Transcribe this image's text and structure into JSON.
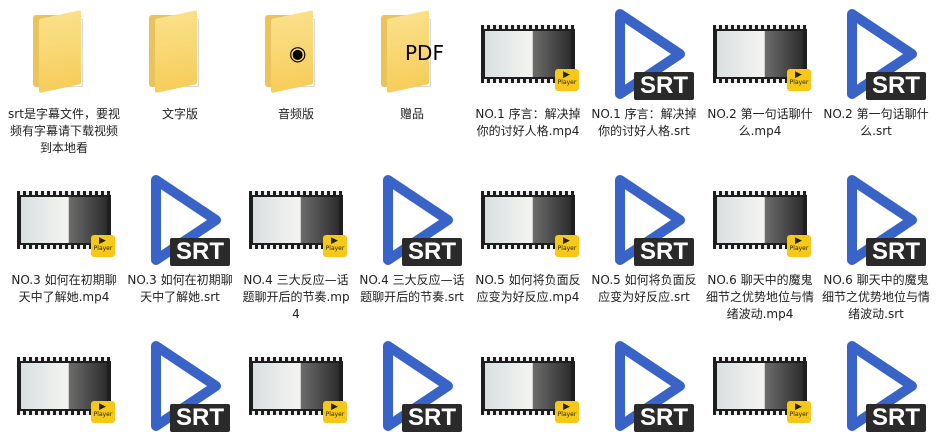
{
  "files": [
    {
      "type": "folder",
      "glyph": "",
      "label": "srt是字幕文件，要视频有字幕请下载视频到本地看"
    },
    {
      "type": "folder",
      "glyph": "",
      "label": "文字版"
    },
    {
      "type": "folder",
      "glyph": "◉",
      "label": "音频版"
    },
    {
      "type": "folder",
      "glyph": "PDF",
      "label": "赠品"
    },
    {
      "type": "video",
      "label": "NO.1 序言：解决掉你的讨好人格.mp4"
    },
    {
      "type": "srt",
      "label": "NO.1 序言：解决掉你的讨好人格.srt"
    },
    {
      "type": "video",
      "label": "NO.2 第一句话聊什么.mp4"
    },
    {
      "type": "srt",
      "label": "NO.2 第一句话聊什么.srt"
    },
    {
      "type": "video",
      "label": "NO.3 如何在初期聊天中了解她.mp4"
    },
    {
      "type": "srt",
      "label": "NO.3 如何在初期聊天中了解她.srt"
    },
    {
      "type": "video",
      "label": "NO.4 三大反应—话题聊开后的节奏.mp4"
    },
    {
      "type": "srt",
      "label": "NO.4 三大反应—话题聊开后的节奏.srt"
    },
    {
      "type": "video",
      "label": "NO.5 如何将负面反应变为好反应.mp4"
    },
    {
      "type": "srt",
      "label": "NO.5 如何将负面反应变为好反应.srt"
    },
    {
      "type": "video",
      "label": "NO.6 聊天中的魔鬼细节之优势地位与情绪波动.mp4"
    },
    {
      "type": "srt",
      "label": "NO.6 聊天中的魔鬼细节之优势地位与情绪波动.srt"
    },
    {
      "type": "video",
      "label": ""
    },
    {
      "type": "srt",
      "label": ""
    },
    {
      "type": "video",
      "label": ""
    },
    {
      "type": "srt",
      "label": ""
    },
    {
      "type": "video",
      "label": ""
    },
    {
      "type": "srt",
      "label": ""
    },
    {
      "type": "video",
      "label": ""
    },
    {
      "type": "srt",
      "label": ""
    }
  ],
  "strings": {
    "srt_tag": "SRT",
    "player_badge": "Player"
  },
  "colors": {
    "srt_play": "#3a63c8",
    "srt_tag": "#2a2a2a",
    "folder": "#f5cd5a",
    "badge": "#f7c815"
  }
}
